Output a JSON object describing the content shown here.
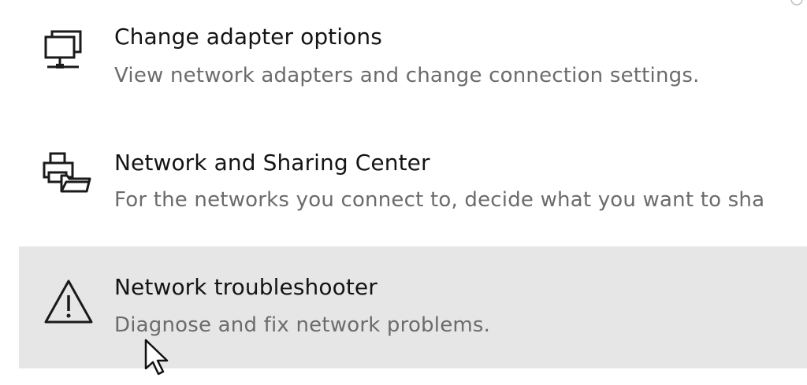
{
  "items": [
    {
      "title": "Change adapter options",
      "description": "View network adapters and change connection settings.",
      "icon": "monitor-network-icon"
    },
    {
      "title": "Network and Sharing Center",
      "description": "For the networks you connect to, decide what you want to sha",
      "icon": "printer-folder-icon"
    },
    {
      "title": "Network troubleshooter",
      "description": "Diagnose and fix network problems.",
      "icon": "warning-icon"
    }
  ],
  "colors": {
    "background": "#ffffff",
    "hover_row": "#e6e6e6",
    "title_text": "#141414",
    "description_text": "#6b6b6b"
  }
}
